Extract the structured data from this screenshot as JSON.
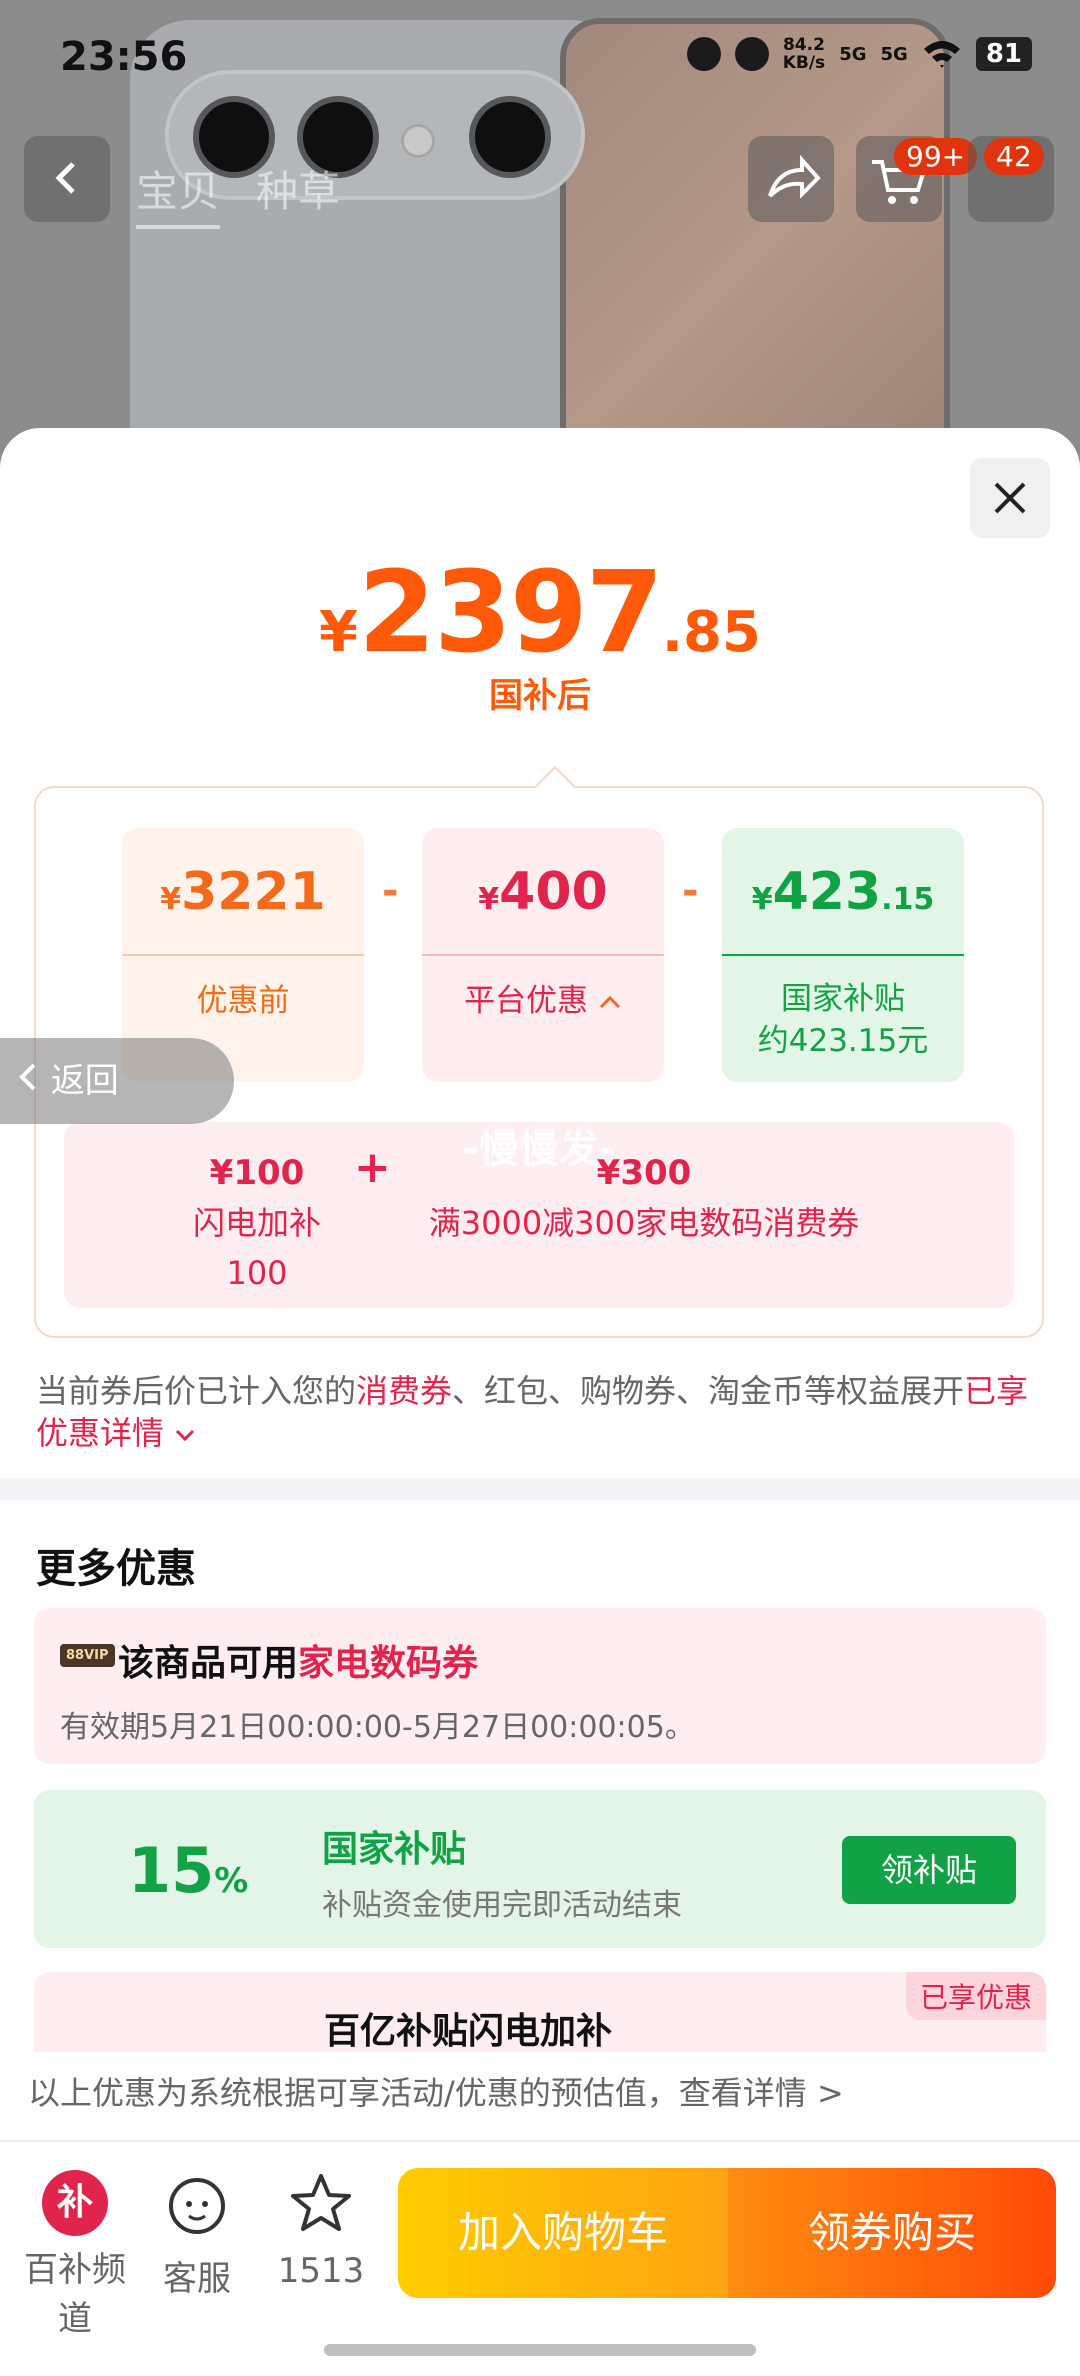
{
  "status": {
    "time": "23:56",
    "speed": "84.2\nKB/s",
    "signal1": "5G",
    "signal2": "5G",
    "battery": "81"
  },
  "nav": {
    "tabs": [
      "宝贝",
      "种草"
    ],
    "cart_badge": "99+",
    "more_badge": "42"
  },
  "price": {
    "symbol": "¥",
    "integer": "2397",
    "decimal": ".85",
    "label": "国补后"
  },
  "breakdown": {
    "before": {
      "symbol": "¥",
      "value": "3221",
      "label": "优惠前"
    },
    "platform": {
      "symbol": "¥",
      "value": "400",
      "label": "平台优惠"
    },
    "subsidy": {
      "symbol": "¥",
      "value": "423",
      "decimal": ".15",
      "label_line1": "国家补贴",
      "label_line2": "约423.15元"
    },
    "minus": "-"
  },
  "platform_detail": {
    "watermark": "-慢慢发-",
    "item1": {
      "amount": "¥100",
      "label": "闪电加补",
      "sub": "100"
    },
    "plus": "+",
    "item2": {
      "amount": "¥300",
      "label": "满3000减300家电数码消费券"
    }
  },
  "note": {
    "part1": "当前券后价已计入您的",
    "hl1": "消费券",
    "part2": "、红包、购物券、淘金币等权益展开",
    "hl2": "已享优惠详情",
    "chev": "⌄"
  },
  "return_label": "返回",
  "more": {
    "title": "更多优惠",
    "card1": {
      "vip": "88VIP",
      "prefix": "该商品可用",
      "highlight": "家电数码券",
      "desc": "有效期5月21日00:00:00-5月27日00:00:05。"
    },
    "card2": {
      "pct": "15",
      "pct_sym": "%",
      "title": "国家补贴",
      "desc": "补贴资金使用完即活动结束",
      "button": "领补贴"
    },
    "card3": {
      "title": "百亿补贴闪电加补",
      "badge": "已享优惠"
    }
  },
  "footnote": "以上优惠为系统根据可享活动/优惠的预估值，查看详情 >",
  "bottom": {
    "channel": {
      "icon": "补",
      "label": "百补频道"
    },
    "service": {
      "label": "客服"
    },
    "fav": {
      "label": "1513"
    },
    "add_cart": "加入购物车",
    "buy": "领券购买"
  },
  "colors": {
    "price_orange": "#ff5a0a",
    "red": "#e1244c",
    "green": "#12a246"
  }
}
